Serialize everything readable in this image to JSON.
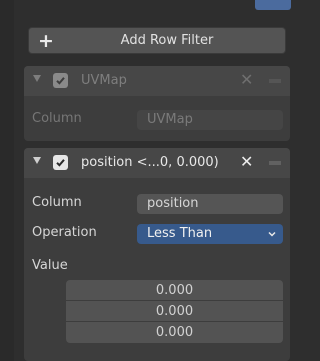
{
  "add_row_filter": {
    "icon": "plus-icon",
    "label": "Add Row Filter"
  },
  "filters": [
    {
      "enabled": true,
      "active": false,
      "title": "UVMap",
      "column_label": "Column",
      "column_value": "UVMap"
    },
    {
      "enabled": true,
      "active": true,
      "title": "position <...0, 0.000)",
      "column_label": "Column",
      "column_value": "position",
      "operation_label": "Operation",
      "operation_value": "Less Than",
      "value_label": "Value",
      "values": [
        "0.000",
        "0.000",
        "0.000"
      ]
    }
  ],
  "colors": {
    "background": "#2e2e2e",
    "panel": "#3d3d3d",
    "panel_header": "#474747",
    "field": "#555555",
    "select_accent": "#375a8c"
  }
}
